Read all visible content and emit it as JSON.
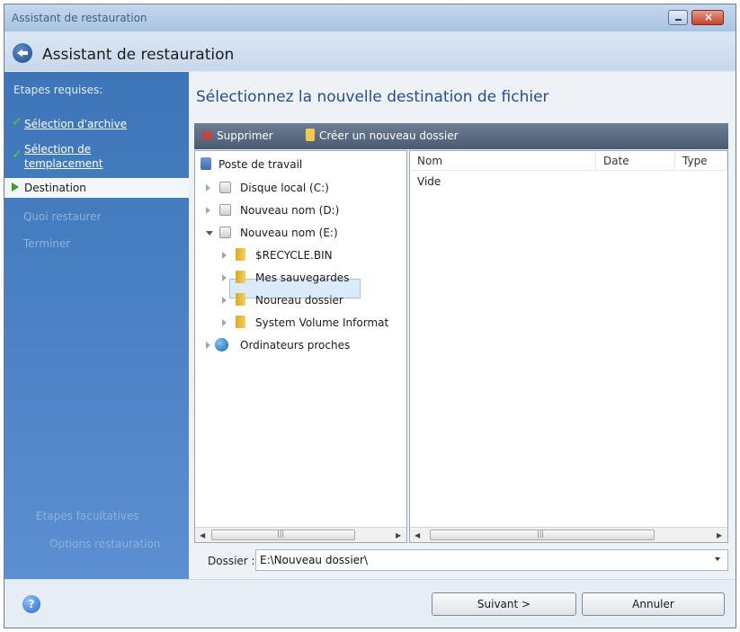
{
  "window": {
    "title": "Assistant de restauration"
  },
  "header": {
    "title": "Assistant de restauration"
  },
  "sidebar": {
    "steps_heading": "Etapes requises:",
    "steps": [
      {
        "label": "Sélection d'archive",
        "state": "done"
      },
      {
        "label": "Sélection de templacement",
        "state": "done"
      },
      {
        "label": "Destination",
        "state": "current"
      },
      {
        "label": "Quoi restaurer",
        "state": "disabled"
      },
      {
        "label": "Terminer",
        "state": "disabled"
      }
    ],
    "optional_heading": "Etapes facultatives",
    "optional_steps": [
      {
        "label": "Options restauration"
      }
    ]
  },
  "main": {
    "title": "Sélectionnez la nouvelle destination de fichier",
    "toolbar": {
      "delete_label": "Supprimer",
      "new_folder_label": "Créer un nouveau dossier"
    },
    "tree": {
      "root": "Poste de travail",
      "drives": [
        "Disque local (C:)",
        "Nouveau nom (D:)",
        "Nouveau nom (E:)"
      ],
      "folders": [
        "$RECYCLE.BIN",
        "Mes sauvegardes",
        "Noureau dossier",
        "System Volume Informat"
      ],
      "network": "Ordinateurs proches"
    },
    "list": {
      "columns": [
        "Nom",
        "Date",
        "Type"
      ],
      "empty_text": "Vide"
    },
    "folder": {
      "label": "Dossier :",
      "value": "E:\\Nouveau dossier\\"
    }
  },
  "footer": {
    "next_label": "Suivant >",
    "cancel_label": "Annuler"
  },
  "colors": {
    "sidebar": "#3d75b8",
    "title_blue": "#264f8a",
    "toolbar": "#5a6b82",
    "check_green": "#5fcc3c"
  }
}
